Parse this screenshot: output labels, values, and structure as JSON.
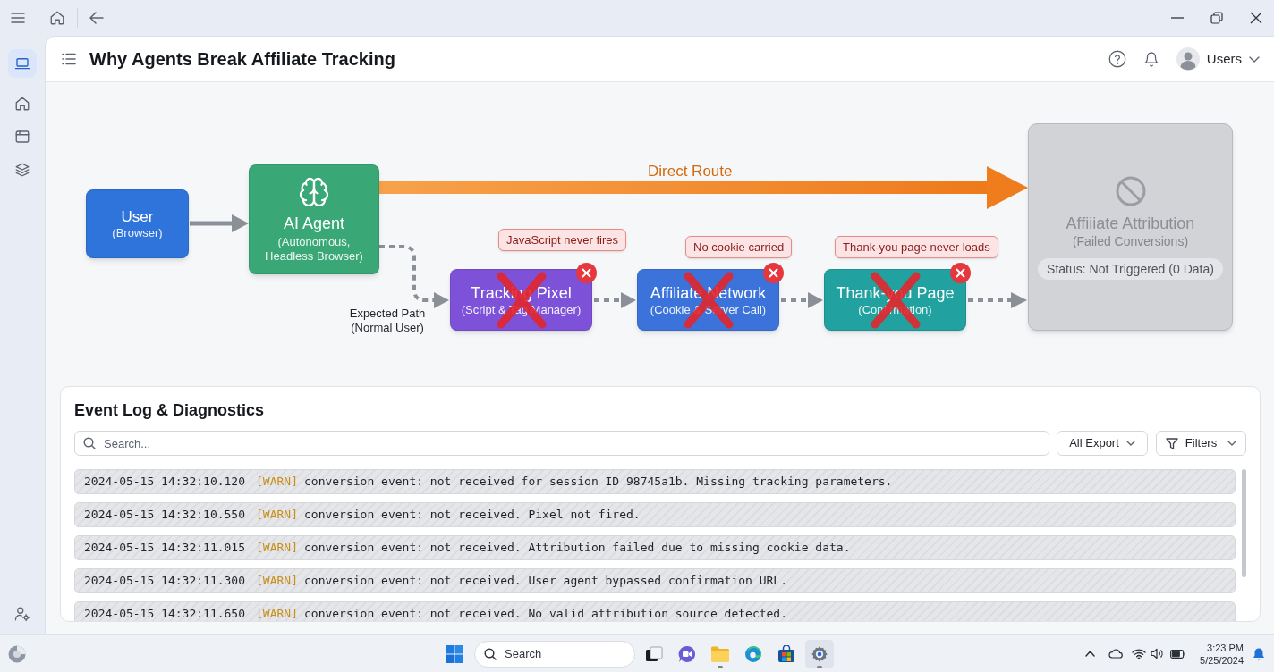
{
  "sidebar": {
    "items": [
      {
        "selected": true
      },
      {
        "selected": false
      },
      {
        "selected": false
      },
      {
        "selected": false
      }
    ]
  },
  "header": {
    "title": "Why Agents Break Affiliate Tracking",
    "user_menu": {
      "label": "Users"
    }
  },
  "diagram": {
    "direct_route": {
      "label": "Direct Route"
    },
    "expected_path": {
      "label": "Expected Path (Normal User)"
    },
    "nodes": [
      {
        "kind": "start",
        "title": "User",
        "subtitle": "(Browser)",
        "color": "#2f74db"
      },
      {
        "kind": "agent",
        "title": "AI Agent",
        "subtitle": "(Autonomous, Headless Browser)",
        "color": "#3aa776"
      },
      {
        "kind": "step",
        "title": "Tracking Pixel",
        "subtitle": "(Script & Tag Manager)",
        "color": "#7d52d9",
        "failed": true,
        "callout": "JavaScript never fires"
      },
      {
        "kind": "step",
        "title": "Affiliate Network",
        "subtitle": "(Cookie & Server Call)",
        "color": "#3b73da",
        "failed": true,
        "callout": "No cookie carried"
      },
      {
        "kind": "step",
        "title": "Thank-you Page",
        "subtitle": "(Confirmation)",
        "color": "#21a19f",
        "failed": true,
        "callout": "Thank-you page never loads"
      },
      {
        "kind": "end",
        "title": "Affiiiate Attribution",
        "subtitle": "(Failed Conversions)",
        "color": "#d1d3d7",
        "status": "Status: Not Triggered (0 Data)"
      }
    ]
  },
  "event_log": {
    "title": "Event Log & Diagnostics",
    "search": {
      "placeholder": "Search..."
    },
    "export_dropdown": {
      "label": "All Export"
    },
    "filters_button": {
      "label": "Filters"
    },
    "entries": [
      {
        "kind": "warn",
        "timestamp": "2024-05-15 14:32:10.120",
        "tag": "[WARN]",
        "message": "conversion event: not received for session ID 98745a1b. Missing tracking parameters."
      },
      {
        "kind": "warn",
        "timestamp": "2024-05-15 14:32:10.550",
        "tag": "[WARN]",
        "message": "conversion event: not received. Pixel not fired."
      },
      {
        "kind": "warn",
        "timestamp": "2024-05-15 14:32:11.015",
        "tag": "[WARN]",
        "message": "conversion event: not received. Attribution failed due to missing cookie data."
      },
      {
        "kind": "warn",
        "timestamp": "2024-05-15 14:32:11.300",
        "tag": "[WARN]",
        "message": "conversion event: not received. User agent bypassed confirmation URL."
      },
      {
        "kind": "warn",
        "timestamp": "2024-05-15 14:32:11.650",
        "tag": "[WARN]",
        "message": "conversion event: not received. No valid attribution source detected."
      }
    ]
  },
  "taskbar": {
    "search": {
      "placeholder": "Search"
    },
    "apps": [
      {
        "selected": false,
        "running": false
      },
      {
        "selected": false,
        "running": false
      },
      {
        "selected": false,
        "running": true
      },
      {
        "selected": false,
        "running": false
      },
      {
        "selected": false,
        "running": false
      },
      {
        "selected": true,
        "running": true
      }
    ],
    "clock": {
      "time": "3:23 PM",
      "date": "5/25/2024"
    }
  }
}
